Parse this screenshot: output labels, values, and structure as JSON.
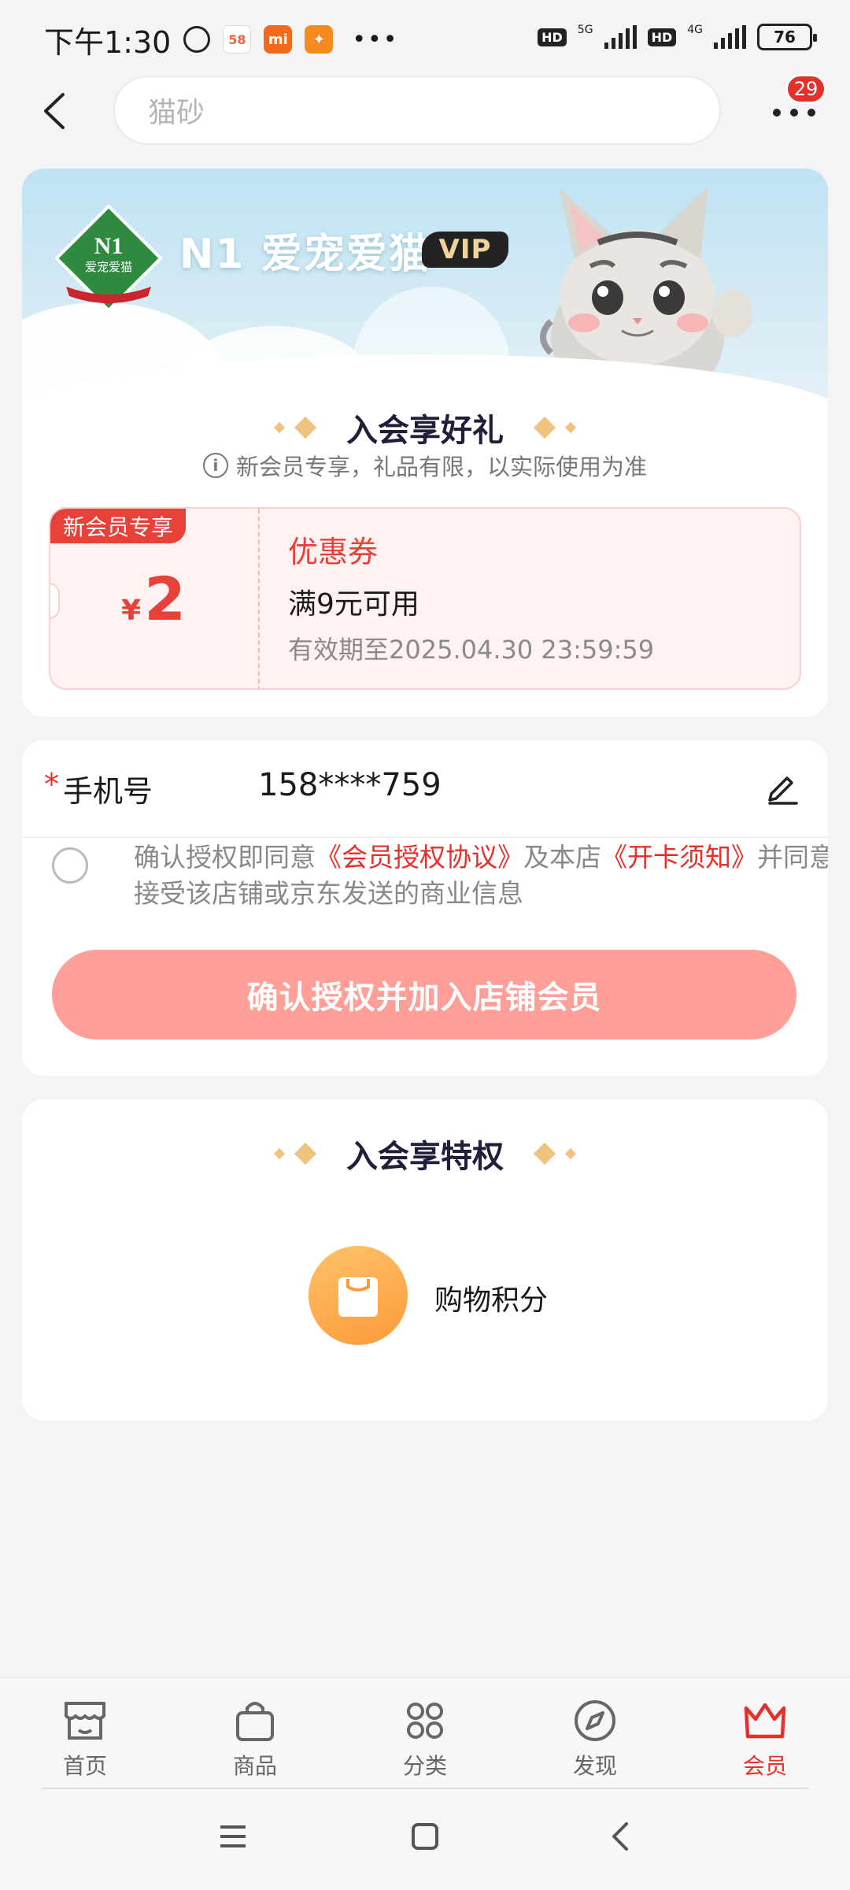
{
  "status_bar": {
    "time": "下午1:30",
    "battery": "76",
    "net1": "5G",
    "net2": "4G",
    "hd": "HD"
  },
  "header": {
    "search_placeholder": "猫砂",
    "badge_count": "29"
  },
  "banner": {
    "brand_name": "N1 爱宠爱猫",
    "vip_label": "VIP",
    "logo_text": "N1",
    "logo_sub": "爱宠爱猫"
  },
  "gift_section": {
    "title": "入会享好礼",
    "notice": "新会员专享，礼品有限，以实际使用为准",
    "coupon": {
      "tag": "新会员专享",
      "currency": "¥",
      "amount": "2",
      "title": "优惠券",
      "condition": "满9元可用",
      "expiry": "有效期至2025.04.30 23:59:59"
    }
  },
  "form": {
    "phone_label": "手机号",
    "required_mark": "*",
    "phone_value": "158****759",
    "agree_prefix": "确认授权即同意",
    "agree_link1": "《会员授权协议》",
    "agree_mid": "及本店",
    "agree_link2": "《开卡须知》",
    "agree_suffix": "并同意接受该店铺或京东发送的商业信息",
    "join_button": "确认授权并加入店铺会员"
  },
  "privilege_section": {
    "title": "入会享特权",
    "items": [
      {
        "label": "购物积分",
        "icon": "shopping-bag-icon"
      }
    ]
  },
  "tabbar": {
    "items": [
      {
        "label": "首页",
        "icon": "storefront-icon"
      },
      {
        "label": "商品",
        "icon": "bag-icon"
      },
      {
        "label": "分类",
        "icon": "category-grid-icon"
      },
      {
        "label": "发现",
        "icon": "compass-icon"
      },
      {
        "label": "会员",
        "icon": "crown-icon",
        "active": true
      }
    ]
  },
  "colors": {
    "accent": "#e4312b",
    "button": "#ff9f98",
    "coupon_bg": "#fff2f1",
    "gold": "#f0c27f"
  }
}
